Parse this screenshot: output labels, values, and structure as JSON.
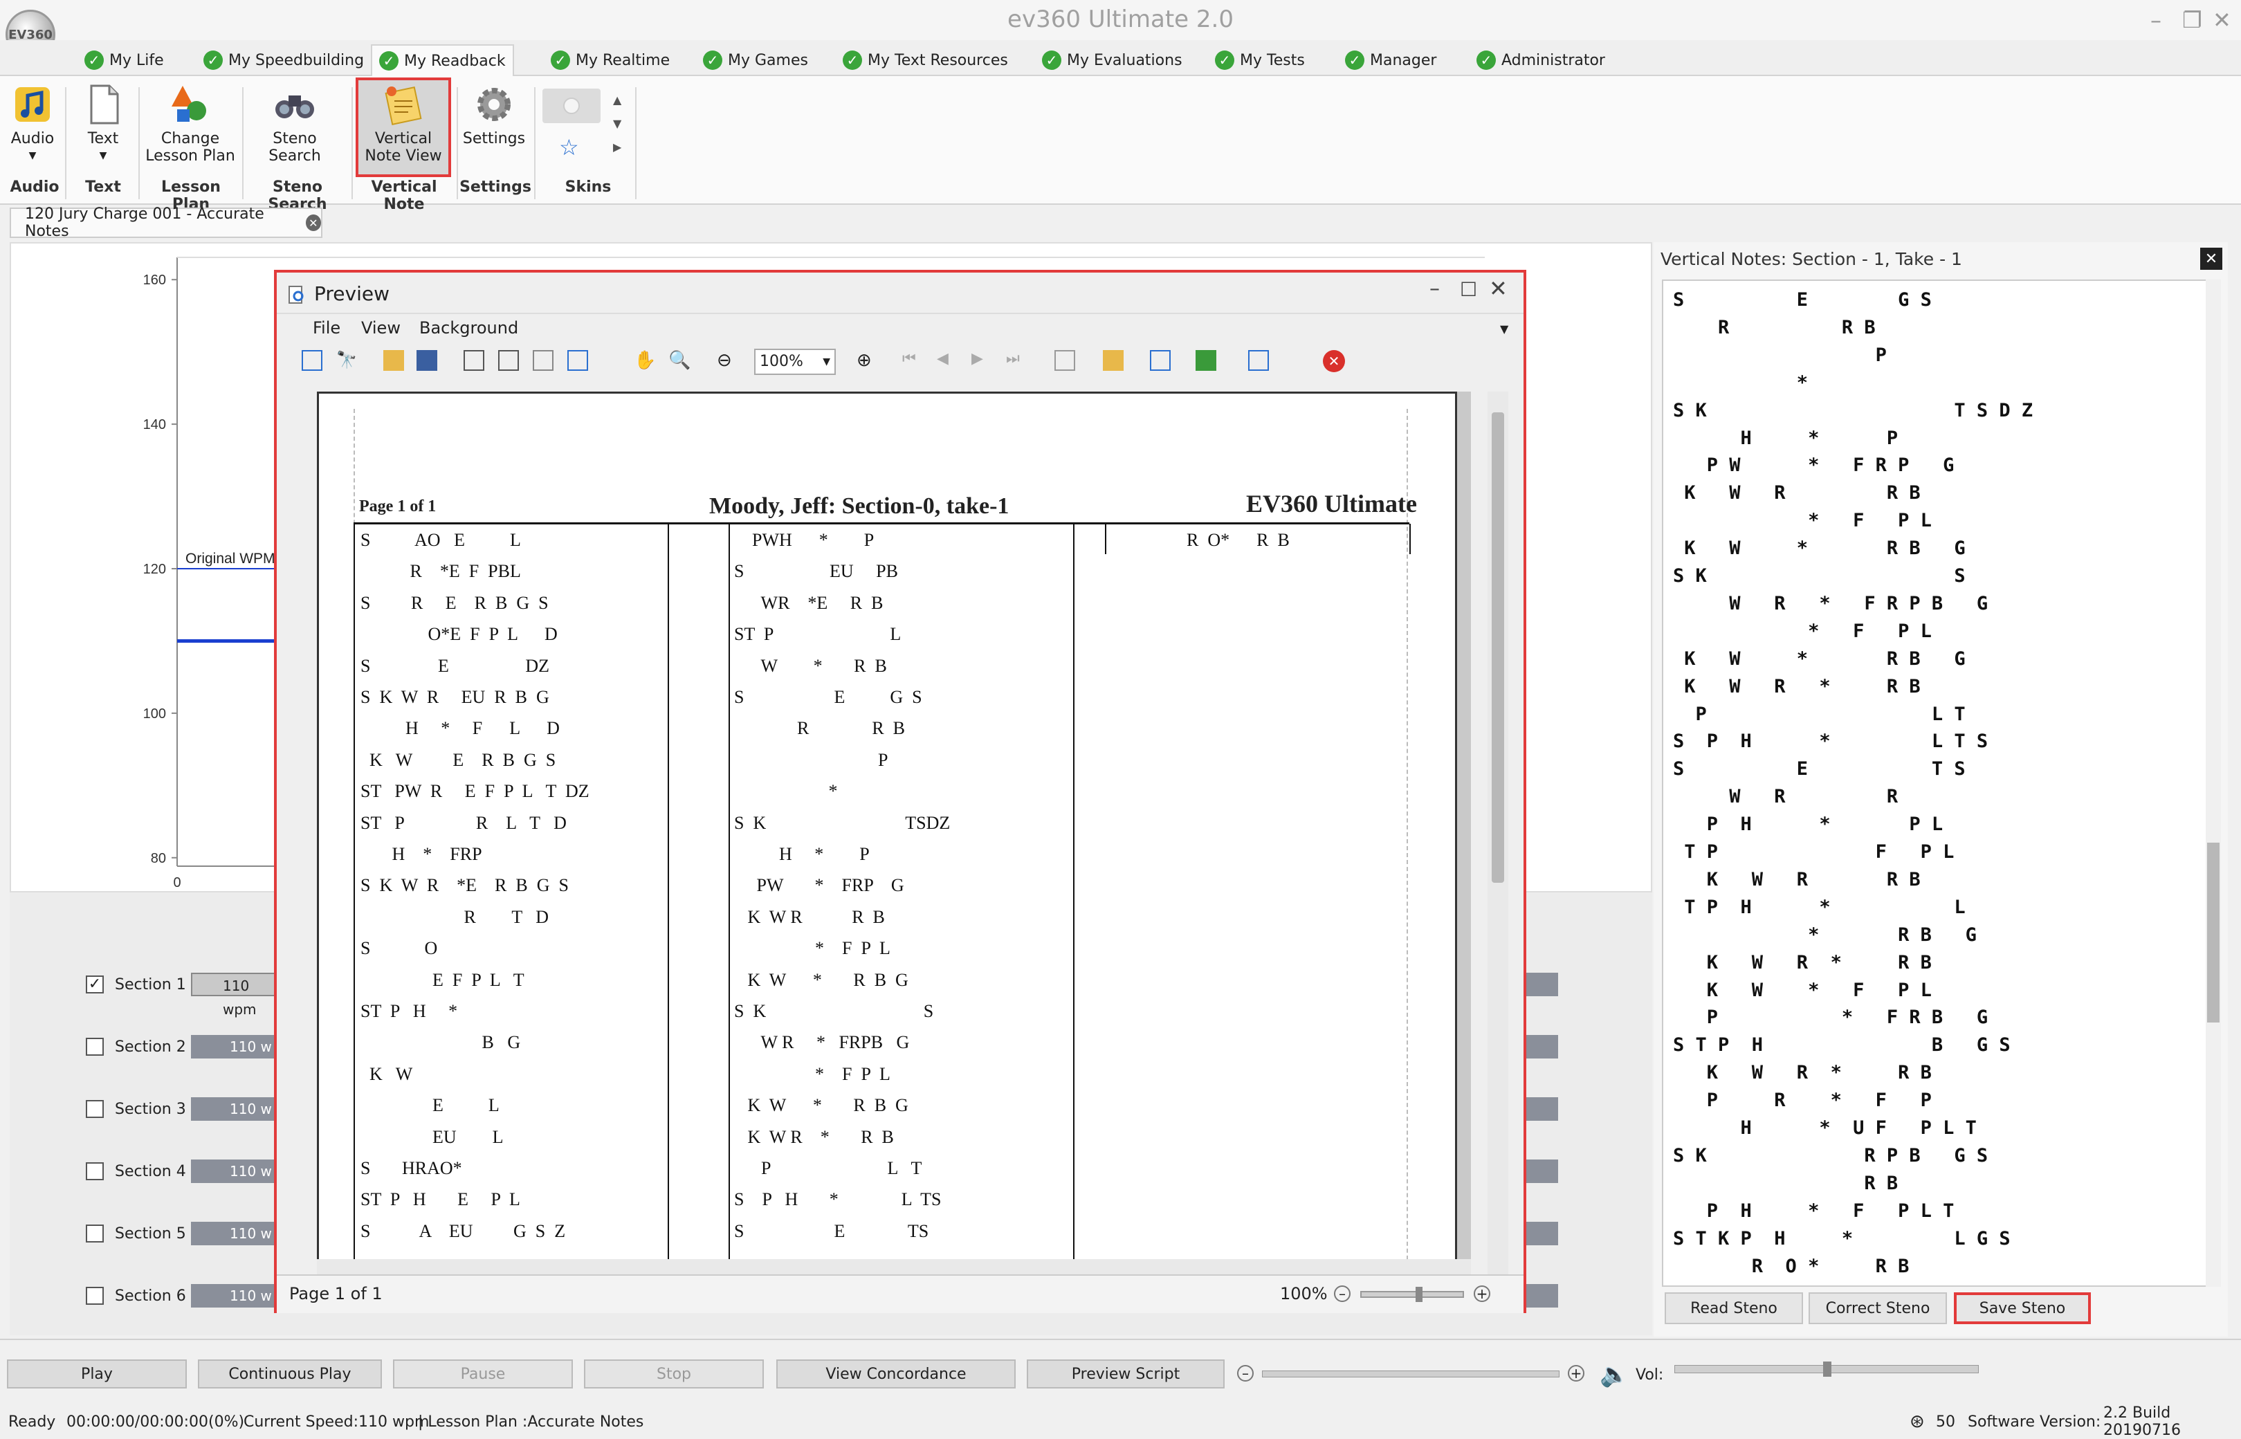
{
  "app": {
    "title": "ev360 Ultimate 2.0",
    "logo_text": "EV360"
  },
  "tabs": [
    "My Life",
    "My Speedbuilding",
    "My Readback",
    "My Realtime",
    "My Games",
    "My Text Resources",
    "My Evaluations",
    "My Tests",
    "Manager",
    "Administrator"
  ],
  "ribbon": {
    "buttons": {
      "audio": "Audio",
      "text": "Text",
      "change_lesson": "Change Lesson Plan",
      "steno_search": "Steno Search",
      "vertical_note": "Vertical Note View",
      "settings": "Settings"
    },
    "groups": {
      "audio": "Audio",
      "text": "Text",
      "lesson": "Lesson Plan",
      "steno": "Steno Search",
      "vertical": "Vertical Note",
      "settings": "Settings",
      "skins": "Skins"
    }
  },
  "doc_tab": "120 Jury Charge 001 - Accurate Notes",
  "chart": {
    "type": "line",
    "yticks": [
      "160",
      "140",
      "120",
      "100",
      "80"
    ],
    "xtick": "0",
    "original_label": "Original WPM",
    "series_value": 110,
    "original_value": 120
  },
  "sections": [
    {
      "label": "Section 1",
      "checked": true,
      "speed": "110 wpm"
    },
    {
      "label": "Section 2",
      "checked": false,
      "speed": "110 w"
    },
    {
      "label": "Section 3",
      "checked": false,
      "speed": "110 w"
    },
    {
      "label": "Section 4",
      "checked": false,
      "speed": "110 w"
    },
    {
      "label": "Section 5",
      "checked": false,
      "speed": "110 w"
    },
    {
      "label": "Section 6",
      "checked": false,
      "speed": "110 w"
    }
  ],
  "vertical_notes": {
    "title": "Vertical Notes: Section - 1, Take - 1",
    "lines": [
      "S          E        G S",
      "    R          R B",
      "                  P",
      "           *",
      "S K                      T S D Z",
      "      H     *      P",
      "   P W      *   F R P   G",
      " K   W   R         R B",
      "            *   F   P L",
      " K   W     *       R B   G",
      "S K                      S",
      "     W   R   *   F R P B   G",
      "            *   F   P L",
      " K   W     *       R B   G",
      " K   W   R   *     R B",
      "  P                    L T",
      "S  P  H      *         L T S",
      "S          E           T S",
      "     W   R         R",
      "   P  H      *       P L",
      " T P              F   P L",
      "   K   W   R       R B",
      " T P  H      *           L",
      "            *       R B   G",
      "   K   W   R  *     R B",
      "   K   W    *   F   P L",
      "   P           *   F R B   G",
      "S T P  H               B   G S",
      "   K   W   R  *     R B",
      "   P     R    *   F   P",
      "      H      *  U F   P L T",
      "S K              R P B   G S",
      "                 R B",
      "   P  H     *   F   P L T",
      "S T K P  H     *         L G S",
      "       R  O *     R B"
    ],
    "buttons": {
      "read": "Read Steno",
      "correct": "Correct Steno",
      "save": "Save Steno"
    }
  },
  "preview": {
    "title": "Preview",
    "menu": [
      "File",
      "View",
      "Background"
    ],
    "zoom": "100%",
    "page_label": "Page 1 of 1",
    "page_title": "Moody, Jeff: Section-0, take-1",
    "brand": "EV360 Ultimate",
    "col1": [
      "S          AO   E          L",
      "           R    *E  F  PBL",
      "S         R     E    R  B  G  S",
      "               O*E  F  P  L      D",
      "S               E                 DZ",
      "S  K  W  R     EU  R  B  G",
      "          H     *     F      L      D",
      "  K   W         E    R  B  G  S",
      "ST   PW  R     E  F  P  L   T  DZ",
      "ST   P                R    L   T   D",
      "       H    *    FRP",
      "S  K  W  R    *E    R  B  G  S",
      "                       R        T   D",
      "S            O",
      "                E  F  P  L   T",
      "ST  P   H     *",
      "                           B   G",
      "  K   W",
      "                E          L",
      "                EU        L",
      "S       HRAO*",
      "ST  P   H       E     P  L",
      "S           A    EU         G  S  Z"
    ],
    "col2": [
      "    PWH      *        P",
      "S                   EU     PB",
      "      WR    *E     R  B",
      "ST  P                          L",
      "      W        *       R  B",
      "S                    E          G  S",
      "              R              R  B",
      "                                P",
      "                     *",
      "S  K                               TSDZ",
      "          H     *        P",
      "     PW       *    FRP    G",
      "   K  W R           R  B",
      "                  *    F  P  L",
      "   K  W      *       R  B  G",
      "S  K                                   S",
      "      W R     *   FRPB   G",
      "                  *    F  P  L",
      "   K  W      *       R  B  G",
      "   K  W R    *       R  B",
      "      P                          L   T",
      "S    P   H       *              L  TS",
      "S                    E              TS"
    ],
    "col3": [
      "R  O*      R  B"
    ],
    "status_page": "Page 1 of 1",
    "status_zoom": "100%"
  },
  "bottom": {
    "play": "Play",
    "continuous": "Continuous Play",
    "pause": "Pause",
    "stop": "Stop",
    "concordance": "View Concordance",
    "preview_script": "Preview  Script",
    "vol_label": "Vol:"
  },
  "status": {
    "ready": "Ready",
    "time": "00:00:00/00:00:00(0%)",
    "speed": "Current Speed:110 wpm",
    "lesson": "| Lesson Plan :Accurate Notes",
    "count": "50",
    "version_label": "Software Version:",
    "version": "2.2 Build 20190716"
  }
}
